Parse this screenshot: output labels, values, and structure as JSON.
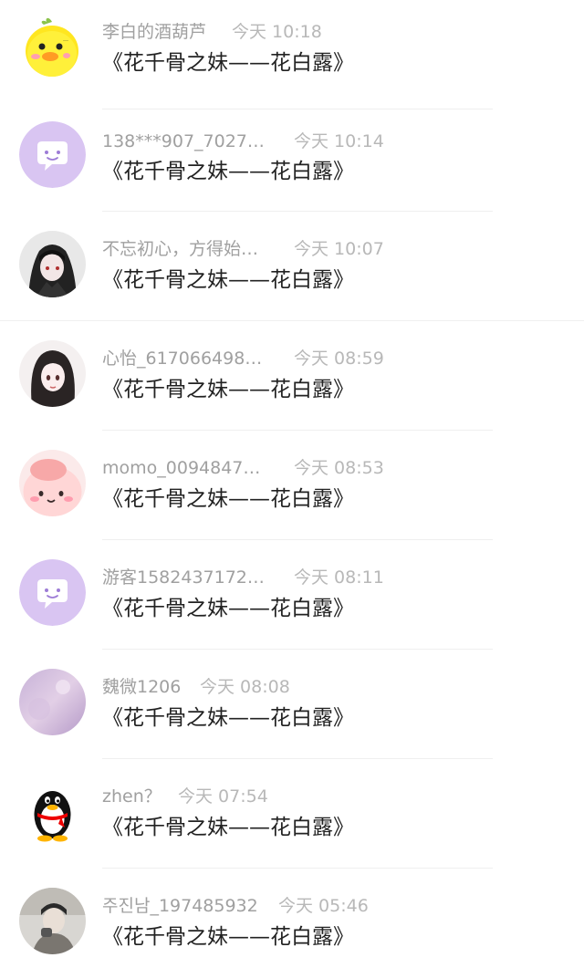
{
  "comments": [
    {
      "user": "李白的酒葫芦",
      "time": "今天 10:18",
      "message": "《花千骨之妹——花白露》",
      "avatar": "yellow-chick-avatar"
    },
    {
      "user": "138***907_7027…",
      "time": "今天 10:14",
      "message": "《花千骨之妹——花白露》",
      "avatar": "default-chat-bubble-avatar"
    },
    {
      "user": "不忘初心，方得始…",
      "time": "今天 10:07",
      "message": "《花千骨之妹——花白露》",
      "avatar": "hooded-anime-avatar"
    },
    {
      "user": "心怡_617066498…",
      "time": "今天 08:59",
      "message": "《花千骨之妹——花白露》",
      "avatar": "anime-girl-avatar"
    },
    {
      "user": "momo_0094847…",
      "time": "今天 08:53",
      "message": "《花千骨之妹——花白露》",
      "avatar": "pink-blob-avatar"
    },
    {
      "user": "游客1582437172…",
      "time": "今天 08:11",
      "message": "《花千骨之妹——花白露》",
      "avatar": "default-chat-bubble-avatar"
    },
    {
      "user": "魏微1206",
      "time": "今天 08:08",
      "message": "《花千骨之妹——花白露》",
      "avatar": "purple-sky-avatar"
    },
    {
      "user": "zhen？",
      "time": "今天 07:54",
      "message": "《花千骨之妹——花白露》",
      "avatar": "qq-penguin-avatar"
    },
    {
      "user": "주진남_197485932",
      "time": "今天 05:46",
      "message": "《花千骨之妹——花白露》",
      "avatar": "photo-person-avatar"
    }
  ],
  "colors": {
    "username": "#a0a0a0",
    "timestamp": "#b8b8b8",
    "message": "#222222",
    "default_avatar_bg": "#d9c5f2",
    "divider": "#efefef"
  }
}
